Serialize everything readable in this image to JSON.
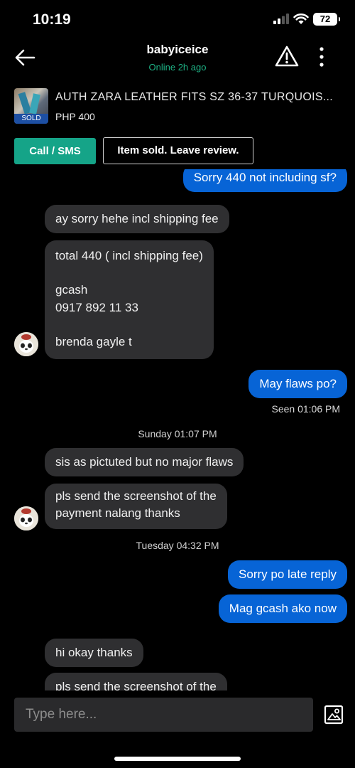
{
  "status_bar": {
    "time": "10:19",
    "battery": "72"
  },
  "header": {
    "title": "babyiceice",
    "status": "Online 2h ago"
  },
  "listing": {
    "title": "AUTH ZARA LEATHER  FITS SZ 36-37 TURQUOIS...",
    "price": "PHP 400",
    "badge": "SOLD"
  },
  "actions": {
    "call_label": "Call / SMS",
    "review_label": "Item sold. Leave review."
  },
  "messages": [
    {
      "dir": "out",
      "text": "Sorry 440 not including sf?"
    },
    {
      "dir": "in",
      "text": "ay sorry hehe incl shipping fee"
    },
    {
      "dir": "in",
      "text": "total 440  ( incl shipping fee)\n\ngcash\n0917 892 11 33\n\nbrenda gayle t"
    },
    {
      "dir": "out",
      "text": "May flaws po?"
    },
    {
      "dir": "in",
      "text": "sis as pictuted but no major flaws"
    },
    {
      "dir": "in",
      "text": "pls send the screenshot of the\npayment nalang thanks"
    },
    {
      "dir": "out",
      "text": "Sorry po late reply"
    },
    {
      "dir": "out",
      "text": "Mag gcash ako now"
    },
    {
      "dir": "in",
      "text": "hi okay thanks"
    },
    {
      "dir": "in",
      "text": "pls send the screenshot of the"
    }
  ],
  "seen_label": "Seen 01:06 PM",
  "date_separators": [
    "Sunday 01:07 PM",
    "Tuesday 04:32 PM"
  ],
  "composer": {
    "placeholder": "Type here..."
  },
  "colors": {
    "outgoing": "#0764d6",
    "incoming": "#2f2f31",
    "accent": "#15a488",
    "online": "#1eb386"
  },
  "icons": [
    "back-arrow-icon",
    "warning-icon",
    "more-vertical-icon",
    "image-upload-icon",
    "cellular-signal-icon",
    "wifi-icon",
    "battery-icon"
  ]
}
